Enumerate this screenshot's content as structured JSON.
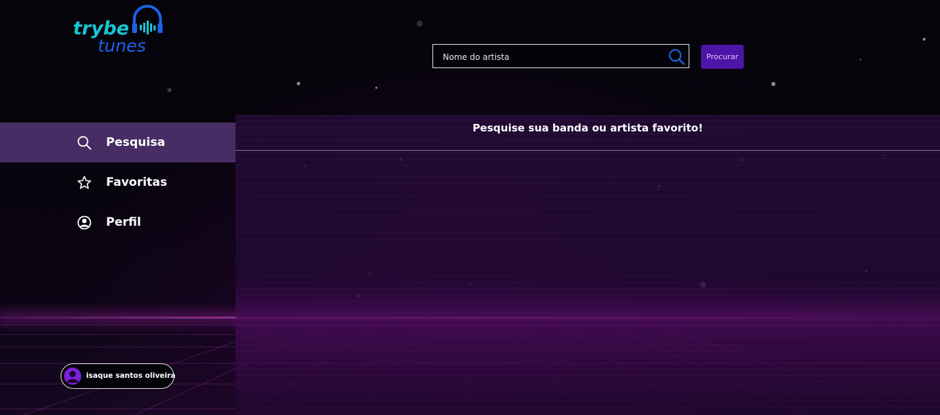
{
  "app": {
    "logo": {
      "line1": "trybe",
      "line2": "tunes"
    }
  },
  "search": {
    "placeholder": "Nome do artista",
    "value": "",
    "button_label": "Procurar"
  },
  "sidebar": {
    "items": [
      {
        "label": "Pesquisa",
        "icon": "search-icon",
        "active": true
      },
      {
        "label": "Favoritas",
        "icon": "star-icon",
        "active": false
      },
      {
        "label": "Perfil",
        "icon": "user-circle-icon",
        "active": false
      }
    ]
  },
  "main": {
    "title": "Pesquise sua banda ou artista favorito!"
  },
  "user": {
    "name": "isaque santos oliveira"
  },
  "colors": {
    "accent": "#4d14a8",
    "logo_cyan": "#17c6d6",
    "logo_blue": "#1b62e6",
    "sidebar_active": "#472d63"
  }
}
